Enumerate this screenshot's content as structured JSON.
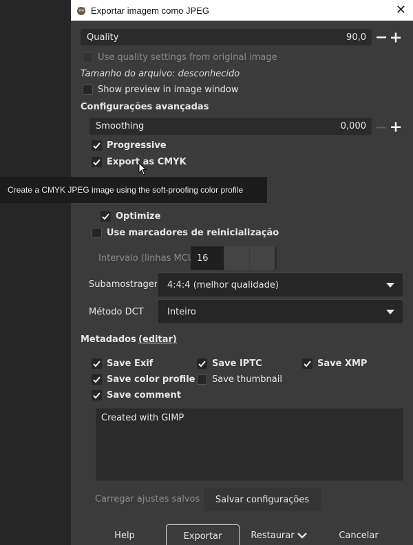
{
  "window": {
    "title": "Exportar imagem como JPEG"
  },
  "quality": {
    "label": "Quality",
    "value": "90,0"
  },
  "use_quality_original": "Use quality settings from original image",
  "file_size": "Tamanho do arquivo: desconhecido",
  "show_preview": "Show preview in image window",
  "advanced": {
    "title": "Configurações avançadas",
    "smoothing_label": "Smoothing",
    "smoothing_value": "0,000",
    "progressive": "Progressive",
    "export_cmyk": "Export as CMYK",
    "tooltip": "Create a CMYK JPEG image using the soft-proofing color profile",
    "optimize": "Optimize",
    "restart_markers": "Use marcadores de reinicialização",
    "interval_label": "Intervalo (linhas MCU):",
    "interval_value": "16",
    "subsampling_label": "Subamostragem",
    "subsampling_value": "4:4:4 (melhor qualidade)",
    "dct_label": "Método DCT",
    "dct_value": "Inteiro"
  },
  "metadata": {
    "title": "Metadados",
    "edit_link": "(editar)",
    "save_exif": "Save Exif",
    "save_iptc": "Save IPTC",
    "save_xmp": "Save XMP",
    "save_color_profile": "Save color profile",
    "save_thumbnail": "Save thumbnail",
    "save_comment": "Save comment",
    "comment_text": "Created with GIMP"
  },
  "settings": {
    "load_saved": "Carregar ajustes salvos",
    "save_settings": "Salvar configurações"
  },
  "buttons": {
    "help": "Help",
    "export": "Exportar",
    "restore": "Restaurar",
    "cancel": "Cancelar"
  }
}
